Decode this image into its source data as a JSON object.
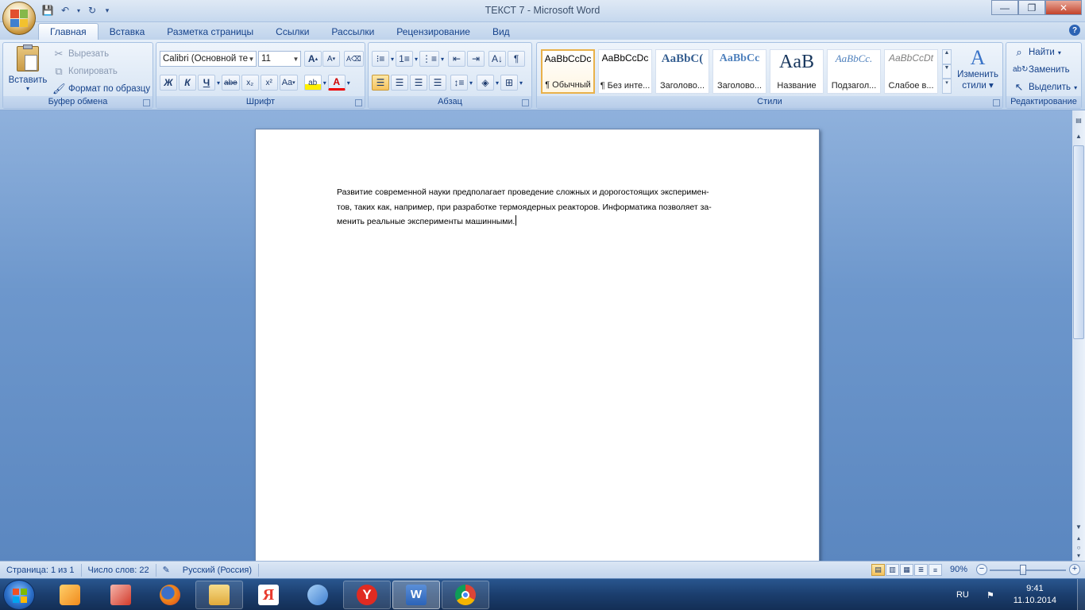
{
  "window": {
    "title": "ТЕКСТ 7 - Microsoft Word",
    "minimize": "—",
    "maximize": "❐",
    "close": "✕"
  },
  "tabs": [
    "Главная",
    "Вставка",
    "Разметка страницы",
    "Ссылки",
    "Рассылки",
    "Рецензирование",
    "Вид"
  ],
  "help_label": "?",
  "ribbon": {
    "clipboard": {
      "title": "Буфер обмена",
      "paste": "Вставить",
      "cut": "Вырезать",
      "copy": "Копировать",
      "format_painter": "Формат по образцу"
    },
    "font": {
      "title": "Шрифт",
      "font_name": "Calibri (Основной те",
      "font_size": "11",
      "grow": "A",
      "shrink": "A",
      "bold": "Ж",
      "italic": "К",
      "underline": "Ч",
      "strike": "abe",
      "sub": "x₂",
      "sup": "x²",
      "case": "Aa",
      "highlight": "ab",
      "font_color": "A"
    },
    "paragraph": {
      "title": "Абзац",
      "show_marks": "¶"
    },
    "styles": {
      "title": "Стили",
      "items": [
        {
          "preview": "AaBbCcDc",
          "name": "¶ Обычный"
        },
        {
          "preview": "AaBbCcDc",
          "name": "¶ Без инте..."
        },
        {
          "preview": "AaBbC(",
          "name": "Заголово..."
        },
        {
          "preview": "AaBbCc",
          "name": "Заголово..."
        },
        {
          "preview": "AaB",
          "name": "Название"
        },
        {
          "preview": "AaBbCc.",
          "name": "Подзагол..."
        },
        {
          "preview": "AaBbCcDt",
          "name": "Слабое в..."
        }
      ],
      "change_styles_line1": "Изменить",
      "change_styles_line2": "стили"
    },
    "editing": {
      "title": "Редактирование",
      "find": "Найти",
      "replace": "Заменить",
      "select": "Выделить"
    }
  },
  "document": {
    "line1": "Развитие современной науки предполагает проведение сложных и дорогостоящих эксперимен-",
    "line2": "тов, таких как, например, при разработке термоядерных реакторов. Информатика позволяет за-",
    "line3": "менить реальные эксперименты машинными."
  },
  "status": {
    "page": "Страница: 1 из 1",
    "words": "Число слов: 22",
    "language": "Русский (Россия)",
    "zoom": "90%",
    "zoom_minus": "−",
    "zoom_plus": "+"
  },
  "taskbar": {
    "lang": "RU",
    "time": "9:41",
    "date": "11.10.2014",
    "apps": [
      {
        "name": "media-player-icon",
        "color": "#f39c2a"
      },
      {
        "name": "graphics-app-icon",
        "color": "#d23b2b"
      },
      {
        "name": "firefox-icon",
        "color": "#e66b18"
      },
      {
        "name": "explorer-icon",
        "color": "#f2c45a"
      },
      {
        "name": "yandex-icon",
        "color": "#e83a2e"
      },
      {
        "name": "sound-icon",
        "color": "#5aa0e0"
      },
      {
        "name": "yandex-browser-icon",
        "color": "#e02b22"
      },
      {
        "name": "word-icon",
        "color": "#2b63b8"
      },
      {
        "name": "chrome-icon",
        "color": "#3c9b43"
      }
    ]
  },
  "colors": {
    "accent": "#15428b",
    "ribbon_bg": "#d5e3f3",
    "workspace_bg": "#6d97cc",
    "taskbar_bg": "#1b3e6e"
  }
}
